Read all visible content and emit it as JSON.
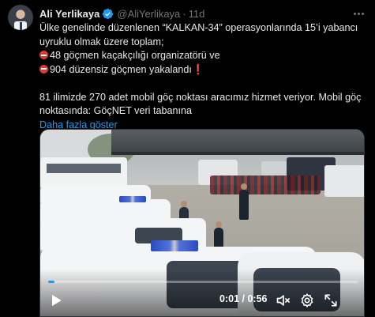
{
  "author": {
    "name": "Ali Yerlikaya",
    "handle": "@AliYerlikaya",
    "separator": "·",
    "time": "11d",
    "avatar_icon": "profile-photo",
    "verified_icon": "verified-badge-icon"
  },
  "tweet": {
    "line1": "Ülke genelinde düzenlenen “KALKAN-34” operasyonlarında 15’i yabancı uyruklu olmak üzere toplam;",
    "line2": "48 göçmen kaçakçılığı organizatörü ve",
    "line3": "904 düzensiz göçmen yakalandı",
    "line3_emoji": "❗",
    "line4": "81 ilimizde 270 adet mobil göç noktası aracımız hizmet veriyor. Mobil göç noktasında: GöçNET veri tabanına",
    "show_more": "Daha fazla göster"
  },
  "video": {
    "current_time": "0:01",
    "duration": "0:56",
    "time_separator": " / ",
    "progress_fraction": 0.02,
    "icons": [
      "play-icon",
      "volume-muted-icon",
      "settings-gear-icon",
      "fullscreen-icon"
    ]
  },
  "colors": {
    "background": "#000000",
    "text": "#e7e9ea",
    "muted": "#71767b",
    "link": "#1d9bf0",
    "verified": "#1d9bf0"
  }
}
